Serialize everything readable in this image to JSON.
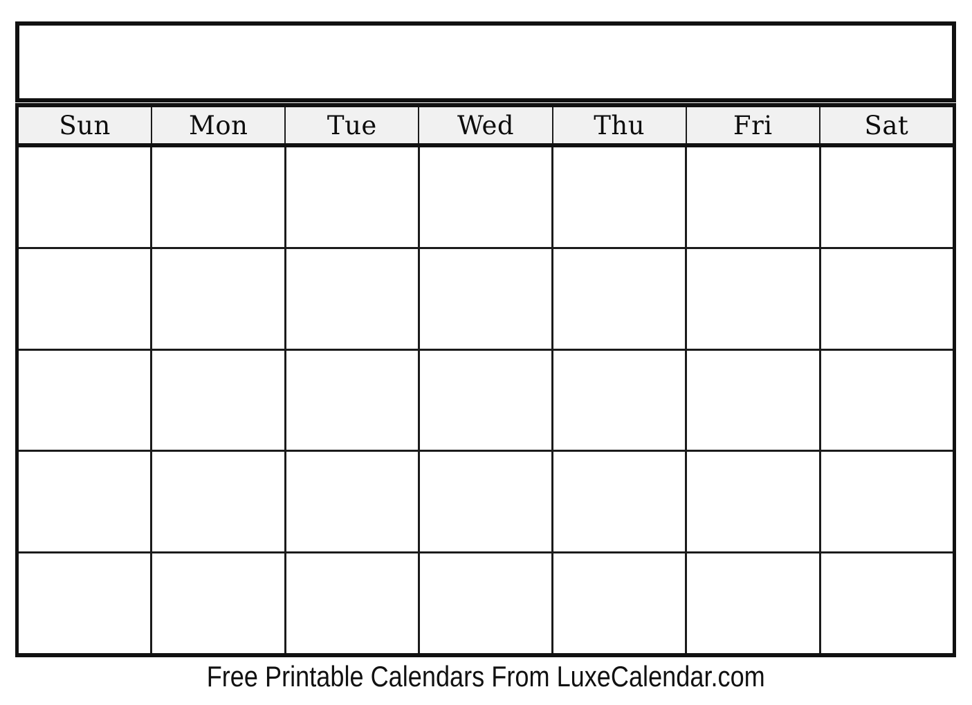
{
  "document": {
    "type": "blank-monthly-calendar-template",
    "background_color": "#ffffff",
    "border_color": "#111111",
    "header_band_color": "#f1f1f1",
    "text_color": "#111111"
  },
  "title_box": {
    "label": "",
    "placeholder": ""
  },
  "weekday_header": {
    "days": [
      {
        "label": "Sun"
      },
      {
        "label": "Mon"
      },
      {
        "label": "Tue"
      },
      {
        "label": "Wed"
      },
      {
        "label": "Thu"
      },
      {
        "label": "Fri"
      },
      {
        "label": "Sat"
      }
    ]
  },
  "grid": {
    "columns": 7,
    "rows": 5,
    "weeks": [
      {
        "cells": [
          {
            "day": ""
          },
          {
            "day": ""
          },
          {
            "day": ""
          },
          {
            "day": ""
          },
          {
            "day": ""
          },
          {
            "day": ""
          },
          {
            "day": ""
          }
        ]
      },
      {
        "cells": [
          {
            "day": ""
          },
          {
            "day": ""
          },
          {
            "day": ""
          },
          {
            "day": ""
          },
          {
            "day": ""
          },
          {
            "day": ""
          },
          {
            "day": ""
          }
        ]
      },
      {
        "cells": [
          {
            "day": ""
          },
          {
            "day": ""
          },
          {
            "day": ""
          },
          {
            "day": ""
          },
          {
            "day": ""
          },
          {
            "day": ""
          },
          {
            "day": ""
          }
        ]
      },
      {
        "cells": [
          {
            "day": ""
          },
          {
            "day": ""
          },
          {
            "day": ""
          },
          {
            "day": ""
          },
          {
            "day": ""
          },
          {
            "day": ""
          },
          {
            "day": ""
          }
        ]
      },
      {
        "cells": [
          {
            "day": ""
          },
          {
            "day": ""
          },
          {
            "day": ""
          },
          {
            "day": ""
          },
          {
            "day": ""
          },
          {
            "day": ""
          },
          {
            "day": ""
          }
        ]
      }
    ]
  },
  "footer": {
    "credit": "Free Printable Calendars From LuxeCalendar.com"
  }
}
